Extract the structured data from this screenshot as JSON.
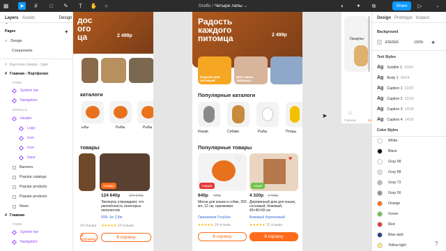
{
  "toolbar": {
    "breadcrumb_left": "Drafts",
    "breadcrumb_sep": "/",
    "file_name": "Четыре лапы",
    "share": "Share"
  },
  "left": {
    "tab_layers": "Layers",
    "tab_assets": "Assets",
    "tab_design": "Design",
    "pages_title": "Pages",
    "page1": "Design",
    "page2": "Components",
    "frame1": "Карточка товара - Цвет",
    "frame2": "Главная - Портфолио",
    "fixed": "FIXED",
    "system_bar": "System bar",
    "navigation": "Navigation",
    "scrolls": "SCROLLS",
    "header": "Header",
    "logo": "Logo",
    "icon1": "Icon",
    "icon2": "Icon",
    "input": "Input",
    "banners": "Banners",
    "popular_catalogs": "Popular catalogs",
    "popular_products1": "Popular products",
    "popular_products2": "Popular products",
    "news": "News",
    "main": "Главная",
    "fixed2": "FIXED",
    "system_bar2": "System bar",
    "navigation2": "Navigation"
  },
  "right": {
    "tab_design": "Design",
    "tab_prototype": "Prototype",
    "tab_inspect": "Inspect",
    "background": "Background",
    "bg_hex": "E5E5E5",
    "bg_opacity": "100%",
    "text_styles": "Text Styles",
    "ts": [
      {
        "n": "Subtitle 1",
        "s": "16/24"
      },
      {
        "n": "Body 1",
        "s": "16/24"
      },
      {
        "n": "Caption 1",
        "s": "12/20"
      },
      {
        "n": "Caption 2",
        "s": "12/14"
      },
      {
        "n": "Caption 3",
        "s": "14/18"
      },
      {
        "n": "Caption 4",
        "s": "14/16"
      }
    ],
    "color_styles": "Color Styles",
    "colors": [
      {
        "n": "White",
        "c": "#ffffff"
      },
      {
        "n": "Black",
        "c": "#111111"
      },
      {
        "n": "Gray 98",
        "c": "#fafafa"
      },
      {
        "n": "Gray 88",
        "c": "#e0e0e0"
      },
      {
        "n": "Gray 72",
        "c": "#b8b8b8"
      },
      {
        "n": "Gray 56",
        "c": "#8f8f8f"
      },
      {
        "n": "Orange",
        "c": "#ff6b1a"
      },
      {
        "n": "Green",
        "c": "#6cc24a"
      },
      {
        "n": "Red",
        "c": "#e53935"
      },
      {
        "n": "Blue dark",
        "c": "#1f3c8a"
      },
      {
        "n": "Yellow light",
        "c": "#ffe680"
      }
    ]
  },
  "canvas": {
    "hero_title": "Радость каждого питомца",
    "price_tag": "2 499р",
    "price_tag_left": "2 499р",
    "card1": "Игрушки для питомцев",
    "card2": "Для самых любимых",
    "catalogs": "Популярные каталоги",
    "cat_cats": "Кошки",
    "cat_dogs": "Собаки",
    "cat_fish": "Рыбы",
    "cat_birds": "Птицы",
    "left_catalogs": "каталоги",
    "left_fish1": "Рыбы",
    "left_fish2": "Рыбы",
    "left_fish3": "ыбы",
    "products": "Популярные товары",
    "left_products": "товары",
    "p1_badge": "Скидка",
    "p1_price": "640р",
    "p1_old": "420р",
    "p1_desc": "Миска для кошек и собак, 200 мл, 12 см, оранжевая",
    "p1_c1": "Оранжевая",
    "p1_c2": "Голубая",
    "p1_rev": "24 отзыва",
    "p2_badge": "Акция",
    "p2_price": "4 320р",
    "p2_old": "4 400р",
    "p2_desc": "Деревянный дом для кошек, сосновый, бежевый, 40×40×60 см",
    "p2_c1": "Бежевый",
    "p2_c2": "Коричневый",
    "p2_rev": "32 отзыва",
    "cart": "В корзину",
    "l_badge": "Скидка",
    "l_price": "124 640р",
    "l_old": "124 640р",
    "l_desc": "Эксперты утверждают, что увлечённость некоторых оппонентов",
    "l_w1": "600г",
    "l_w2": "1кг",
    "l_w3": "2,8кг",
    "l_rev1": "24 отзыва",
    "l_rev2": "24 отзыва",
    "toy": "Грызуны",
    "nav_main": "Главная",
    "nav_cat": "Ка"
  }
}
